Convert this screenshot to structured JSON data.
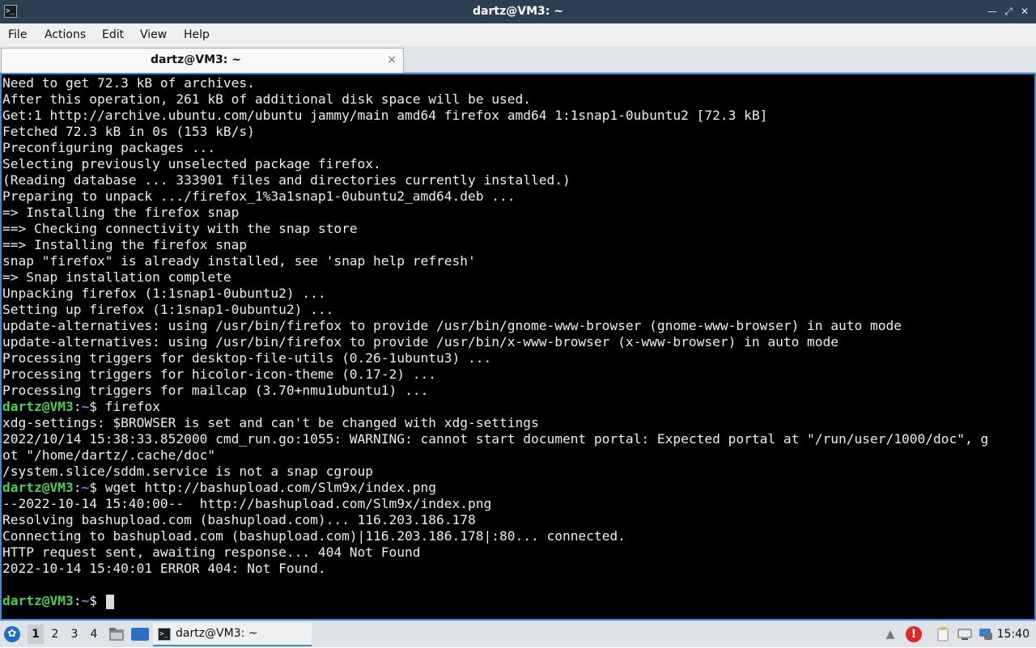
{
  "window": {
    "title": "dartz@VM3: ~"
  },
  "menu": [
    "File",
    "Actions",
    "Edit",
    "View",
    "Help"
  ],
  "tab": {
    "label": "dartz@VM3: ~",
    "close": "×"
  },
  "terminal": {
    "lines": [
      "Need to get 72.3 kB of archives.",
      "After this operation, 261 kB of additional disk space will be used.",
      "Get:1 http://archive.ubuntu.com/ubuntu jammy/main amd64 firefox amd64 1:1snap1-0ubuntu2 [72.3 kB]",
      "Fetched 72.3 kB in 0s (153 kB/s)",
      "Preconfiguring packages ...",
      "Selecting previously unselected package firefox.",
      "(Reading database ... 333901 files and directories currently installed.)",
      "Preparing to unpack .../firefox_1%3a1snap1-0ubuntu2_amd64.deb ...",
      "=> Installing the firefox snap",
      "==> Checking connectivity with the snap store",
      "==> Installing the firefox snap",
      "snap \"firefox\" is already installed, see 'snap help refresh'",
      "=> Snap installation complete",
      "Unpacking firefox (1:1snap1-0ubuntu2) ...",
      "Setting up firefox (1:1snap1-0ubuntu2) ...",
      "update-alternatives: using /usr/bin/firefox to provide /usr/bin/gnome-www-browser (gnome-www-browser) in auto mode",
      "update-alternatives: using /usr/bin/firefox to provide /usr/bin/x-www-browser (x-www-browser) in auto mode",
      "Processing triggers for desktop-file-utils (0.26-1ubuntu3) ...",
      "Processing triggers for hicolor-icon-theme (0.17-2) ...",
      "Processing triggers for mailcap (3.70+nmu1ubuntu1) ...",
      {
        "prompt": "dartz@VM3",
        "path": "~",
        "cmd": " firefox"
      },
      "xdg-settings: $BROWSER is set and can't be changed with xdg-settings",
      "2022/10/14 15:38:33.852000 cmd_run.go:1055: WARNING: cannot start document portal: Expected portal at \"/run/user/1000/doc\", g",
      "ot \"/home/dartz/.cache/doc\"",
      "/system.slice/sddm.service is not a snap cgroup",
      {
        "prompt": "dartz@VM3",
        "path": "~",
        "cmd": " wget http://bashupload.com/Slm9x/index.png"
      },
      "--2022-10-14 15:40:00--  http://bashupload.com/Slm9x/index.png",
      "Resolving bashupload.com (bashupload.com)... 116.203.186.178",
      "Connecting to bashupload.com (bashupload.com)|116.203.186.178|:80... connected.",
      "HTTP request sent, awaiting response... 404 Not Found",
      "2022-10-14 15:40:01 ERROR 404: Not Found.",
      "",
      {
        "prompt": "dartz@VM3",
        "path": "~",
        "cmd": " ",
        "cursor": true
      }
    ]
  },
  "taskbar": {
    "workspaces": [
      "1",
      "2",
      "3",
      "4"
    ],
    "active_workspace": "1",
    "task_label": "dartz@VM3: ~",
    "clock": "15:40",
    "icons": [
      "start-menu-icon",
      "file-manager-icon",
      "show-desktop-icon",
      "terminal-icon",
      "update-notifier-icon",
      "warning-icon",
      "clipboard-icon",
      "network-icon",
      "chat-icon"
    ]
  },
  "colors": {
    "titlebar": "#2c3e51",
    "prompt": "#47d14c",
    "path": "#4d8ff0",
    "focus": "#3b8bd6"
  }
}
